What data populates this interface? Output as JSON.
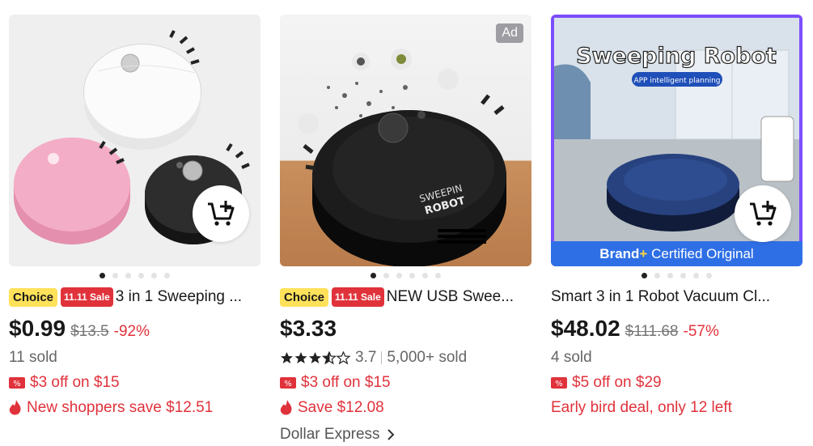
{
  "products": [
    {
      "badges": {
        "choice": "Choice",
        "sale": "11.11 Sale"
      },
      "title": "3 in 1 Sweeping ...",
      "price": "$0.99",
      "original_price": "$13.5",
      "discount": "-92%",
      "sold": "11 sold",
      "coupon": "$3 off on $15",
      "offer": "New shoppers save $12.51"
    },
    {
      "ad_label": "Ad",
      "badges": {
        "choice": "Choice",
        "sale": "11.11 Sale"
      },
      "title": "NEW USB Swee...",
      "price": "$3.33",
      "rating_value": 3.7,
      "rating": "3.7",
      "sold": "5,000+ sold",
      "coupon": "$3 off on $15",
      "offer": "Save $12.08",
      "store": "Dollar Express",
      "image_text": {
        "brand_line1": "SWEEPIN",
        "brand_line2": "ROBOT"
      }
    },
    {
      "image_text": {
        "headline": "Sweeping Robot",
        "subline": "APP intelligent planning"
      },
      "brand_bar": {
        "brand": "Brand",
        "plus": "+",
        "label": "Certified Original"
      },
      "title": "Smart 3 in 1 Robot Vacuum Cl...",
      "price": "$48.02",
      "original_price": "$111.68",
      "discount": "-57%",
      "sold": "4 sold",
      "coupon": "$5 off on $29",
      "offer": "Early bird deal, only 12 left"
    }
  ],
  "carousel": {
    "count": 6,
    "active": 0
  },
  "colors": {
    "accent_red": "#e0323b",
    "choice_yellow": "#ffe15a",
    "brand_blue": "#2e6fe6",
    "frame_purple": "#7c4dff"
  }
}
